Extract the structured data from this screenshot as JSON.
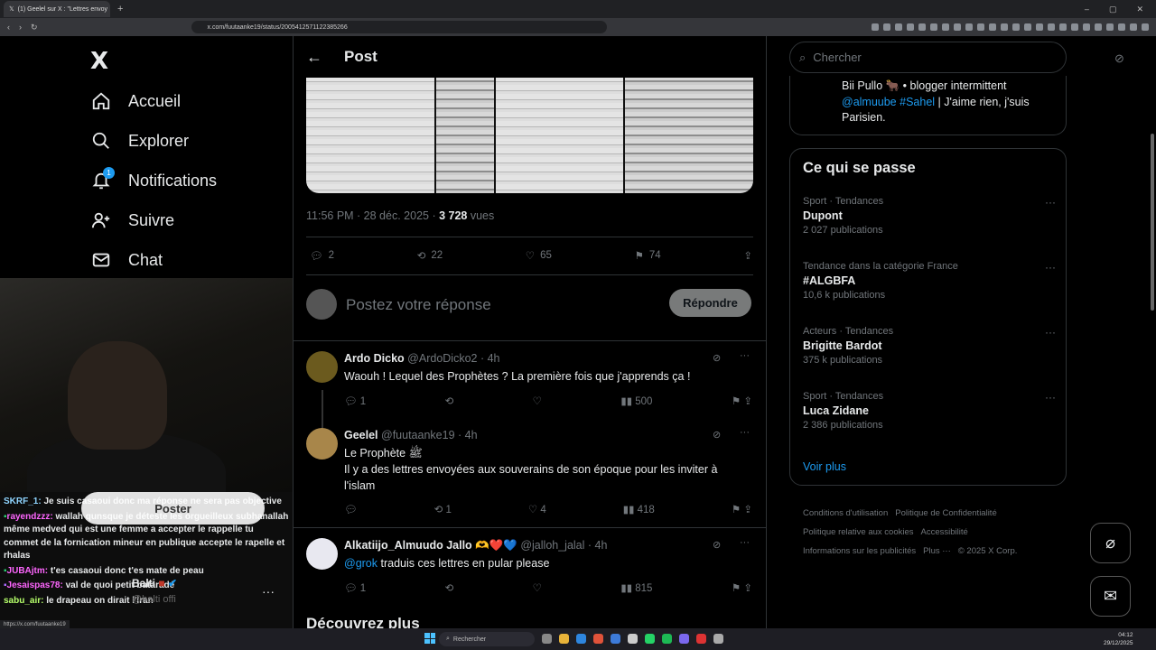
{
  "browser": {
    "tab_title": "(1) Geelel sur X : \"Lettres envoy",
    "url": "x.com/fuutaanke19/status/2005412571122385266"
  },
  "sidebar": {
    "logo": "X",
    "nav": [
      {
        "label": "Accueil",
        "icon": "home-icon"
      },
      {
        "label": "Explorer",
        "icon": "search-icon"
      },
      {
        "label": "Notifications",
        "icon": "bell-icon",
        "badge": "1"
      },
      {
        "label": "Suivre",
        "icon": "follow-icon"
      },
      {
        "label": "Chat",
        "icon": "mail-icon"
      }
    ]
  },
  "stream_chat": {
    "messages": [
      {
        "user": "SKRF_1:",
        "text": "Je suis casaoui donc ma réponse ne sera pas objective",
        "color": "#8fd4ff"
      },
      {
        "user": "rayendzzz:",
        "text": "wallah qunsque je déteste les orgueilleux subhanallah même medved qui est une femme a accepter le rappelle tu commet de la fornication mineur en publique accepte le rapelle et rhalas",
        "color": "#ff66ff"
      },
      {
        "user": "JUBAjtm:",
        "text": "t'es casaoui donc t'es mate de peau",
        "color": "#ff66ff"
      },
      {
        "user": "Jesaispas78:",
        "text": "val de quoi petit bataradé",
        "color": "#ff66ff"
      },
      {
        "user": "sabu_air:",
        "text": "le drapeau on dirait l'iran",
        "color": "#b6ff6b"
      }
    ],
    "overlay_button": "Poster",
    "overlay_user": "Balti",
    "overlay_handle": "@balti offi",
    "status_url": "https://x.com/fuutaanke19"
  },
  "main": {
    "header_title": "Post",
    "post_time": "11:56 PM · 28 déc. 2025 · ",
    "post_views": "3 728",
    "post_views_label": " vues",
    "actions": {
      "replies": "2",
      "reposts": "22",
      "likes": "65",
      "bookmarks": "74"
    },
    "reply_placeholder": "Postez votre réponse",
    "reply_button": "Répondre",
    "replies": [
      {
        "name": "Ardo Dicko",
        "handle": "@ArdoDicko2 · 4h",
        "text": "Waouh ! Lequel des Prophètes ? La première fois que j'apprends ça !",
        "replies": "1",
        "reposts": "",
        "likes": "",
        "views": "500"
      },
      {
        "name": "Geelel",
        "handle": "@fuutaanke19 · 4h",
        "text1": "Le Prophète ﷺ",
        "text2": "Il y a des lettres envoyées aux souverains de son époque pour les inviter à l'islam",
        "replies": "",
        "reposts": "1",
        "likes": "4",
        "views": "418"
      },
      {
        "name": "Alkatiijo_Almuudo Jallo 🫶❤️💙",
        "handle": "@jalloh_jalal · 4h",
        "mention": "@grok",
        "text": " traduis ces lettres en pular please",
        "replies": "1",
        "reposts": "",
        "likes": "",
        "views": "815"
      }
    ],
    "discover": "Découvrez plus"
  },
  "right": {
    "search_placeholder": "Chercher",
    "bio_line1": "Bii Pullo 🐂 • blogger intermittent",
    "bio_mention1": "@almuube",
    "bio_mention2": "#Sahel",
    "bio_rest": " | J'aime rien, j'suis Parisien.",
    "trends_title": "Ce qui se passe",
    "trends": [
      {
        "category": "Sport · Tendances",
        "name": "Dupont",
        "count": "2 027 publications"
      },
      {
        "category": "Tendance dans la catégorie France",
        "name": "#ALGBFA",
        "count": "10,6 k publications"
      },
      {
        "category": "Acteurs · Tendances",
        "name": "Brigitte Bardot",
        "count": "375 k publications"
      },
      {
        "category": "Sport · Tendances",
        "name": "Luca Zidane",
        "count": "2 386 publications"
      }
    ],
    "show_more": "Voir plus",
    "footer": [
      "Conditions d'utilisation",
      "Politique de Confidentialité",
      "Politique relative aux cookies",
      "Accessibilité",
      "Informations sur les publicités",
      "Plus ···",
      "© 2025 X Corp."
    ]
  },
  "taskbar": {
    "search": "Rechercher",
    "time": "04:12",
    "date": "29/12/2025"
  },
  "colors": {
    "accent": "#1d9bf0",
    "background": "#000000",
    "border": "#2f3336",
    "muted": "#71767b"
  }
}
